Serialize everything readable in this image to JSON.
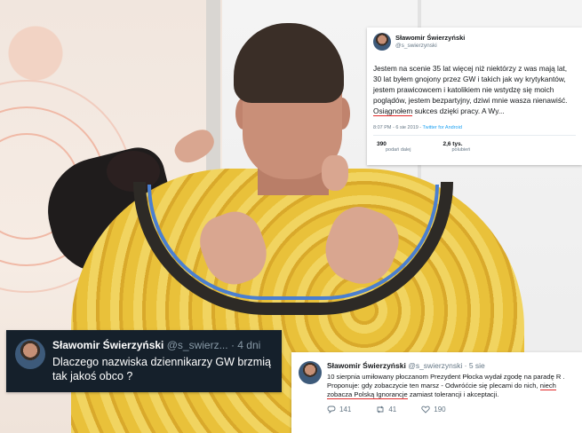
{
  "top_tweet": {
    "author_name": "Sławomir Świerzyński",
    "author_handle": "@s_swierzynski",
    "text_part1": "Jestem na scenie 35 lat więcej niż niektórzy z was mają lat, 30 lat byłem gnojony przez GW i takich jak wy krytykantów, jestem prawicowcem i katolikiem nie wstydzę się moich poglądów, jestem bezpartyjny, dziwi mnie wasza nienawiść. ",
    "text_underlined": "Osiągnołem",
    "text_part2": " sukces dzięki pracy. A Wy...",
    "timestamp": "8:07 PM - 6 sie 2019 - ",
    "source": "Twitter for Android",
    "retweets_count": "390",
    "retweets_label": "podań dalej",
    "likes_count": "2,6 tys.",
    "likes_label": "polubień"
  },
  "dark_tweet": {
    "author_name": "Sławomir Świerzyński",
    "author_handle": "@s_swierz...",
    "time": "· 4 dni",
    "text": "Dlaczego nazwiska dziennikarzy GW brzmią tak jakoś obco ?"
  },
  "bottom_tweet": {
    "author_name": "Sławomir Świerzyński",
    "author_handle": "@s_swierzynski · 5 sie",
    "text_part1": "10 sierpnia umiłowany płoczanom Prezydent Płocka wydał zgodę na paradę R . Proponuje: gdy zobaczycie ten marsz - Odwróćcie się plecami do nich, ",
    "text_underlined": "niech zobacza Polską Ignorancje",
    "text_part2": " zamiast tolerancji i akceptacji.",
    "replies": "141",
    "retweets": "41",
    "likes": "190"
  },
  "icons": {
    "reply": "reply-icon",
    "retweet": "retweet-icon",
    "like": "heart-icon"
  },
  "colors": {
    "underline": "#e12a2a",
    "dark_card": "#15202b",
    "link": "#1da1f2"
  }
}
